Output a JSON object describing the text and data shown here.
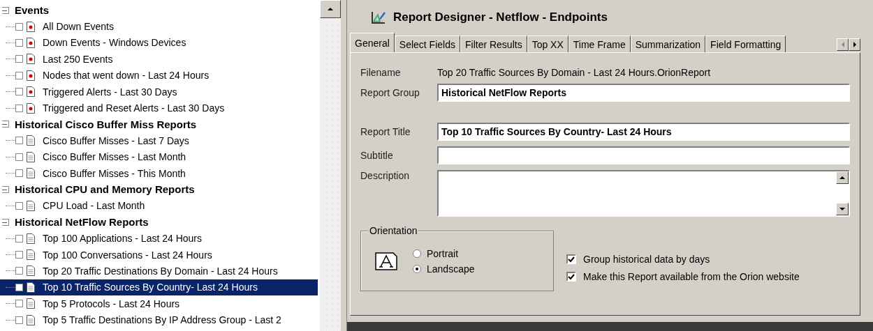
{
  "tree": [
    {
      "label": "Events",
      "expanded": true,
      "children": [
        {
          "label": "All Down Events",
          "kind": "alert",
          "checked": false,
          "selected": false
        },
        {
          "label": "Down Events - Windows Devices",
          "kind": "alert",
          "checked": false,
          "selected": false
        },
        {
          "label": "Last 250 Events",
          "kind": "alert",
          "checked": false,
          "selected": false
        },
        {
          "label": "Nodes that went down - Last 24 Hours",
          "kind": "alert",
          "checked": false,
          "selected": false
        },
        {
          "label": "Triggered Alerts - Last 30 Days",
          "kind": "alert",
          "checked": false,
          "selected": false
        },
        {
          "label": "Triggered and Reset Alerts - Last 30 Days",
          "kind": "alert",
          "checked": false,
          "selected": false
        }
      ]
    },
    {
      "label": "Historical Cisco Buffer Miss Reports",
      "expanded": true,
      "children": [
        {
          "label": "Cisco Buffer Misses - Last 7 Days",
          "kind": "report",
          "checked": false,
          "selected": false
        },
        {
          "label": "Cisco Buffer Misses - Last Month",
          "kind": "report",
          "checked": false,
          "selected": false
        },
        {
          "label": "Cisco Buffer Misses - This Month",
          "kind": "report",
          "checked": false,
          "selected": false
        }
      ]
    },
    {
      "label": "Historical CPU and Memory Reports",
      "expanded": true,
      "children": [
        {
          "label": "CPU Load - Last Month",
          "kind": "report",
          "checked": false,
          "selected": false
        }
      ]
    },
    {
      "label": "Historical NetFlow Reports",
      "expanded": true,
      "children": [
        {
          "label": "Top 100 Applications - Last 24 Hours",
          "kind": "report",
          "checked": false,
          "selected": false
        },
        {
          "label": "Top 100 Conversations - Last 24 Hours",
          "kind": "report",
          "checked": false,
          "selected": false
        },
        {
          "label": "Top 20 Traffic Destinations By Domain - Last 24 Hours",
          "kind": "report",
          "checked": false,
          "selected": false
        },
        {
          "label": "Top 10 Traffic Sources By Country- Last 24 Hours",
          "kind": "report",
          "checked": false,
          "selected": true
        },
        {
          "label": "Top 5 Protocols - Last 24 Hours",
          "kind": "report",
          "checked": false,
          "selected": false
        },
        {
          "label": "Top 5 Traffic Destinations By IP Address Group - Last 2",
          "kind": "report",
          "checked": false,
          "selected": false
        }
      ]
    }
  ],
  "window": {
    "title": "Report Designer - Netflow - Endpoints"
  },
  "tabs": [
    {
      "label": "General",
      "selected": true
    },
    {
      "label": "Select Fields",
      "selected": false
    },
    {
      "label": "Filter Results",
      "selected": false
    },
    {
      "label": "Top XX",
      "selected": false
    },
    {
      "label": "Time Frame",
      "selected": false
    },
    {
      "label": "Summarization",
      "selected": false
    },
    {
      "label": "Field Formatting",
      "selected": false
    }
  ],
  "filename": {
    "label": "Filename",
    "value": "Top 20 Traffic Sources By Domain - Last 24 Hours.OrionReport"
  },
  "fields": [
    {
      "label": "Report Group",
      "value": "Historical NetFlow Reports",
      "kind": "line"
    },
    {
      "label": "Report Title",
      "value": "Top 10 Traffic Sources By Country- Last 24 Hours",
      "kind": "line"
    },
    {
      "label": "Subtitle",
      "kind": "line"
    },
    {
      "label": "Description",
      "kind": "memo"
    }
  ],
  "orientation": {
    "label": "Orientation",
    "options": [
      {
        "label": "Portrait",
        "selected": false
      },
      {
        "label": "Landscape",
        "selected": true
      }
    ]
  },
  "options": [
    {
      "label": "Group historical data by days",
      "checked": true
    },
    {
      "label": "Make this Report available from the Orion website",
      "checked": true
    }
  ]
}
